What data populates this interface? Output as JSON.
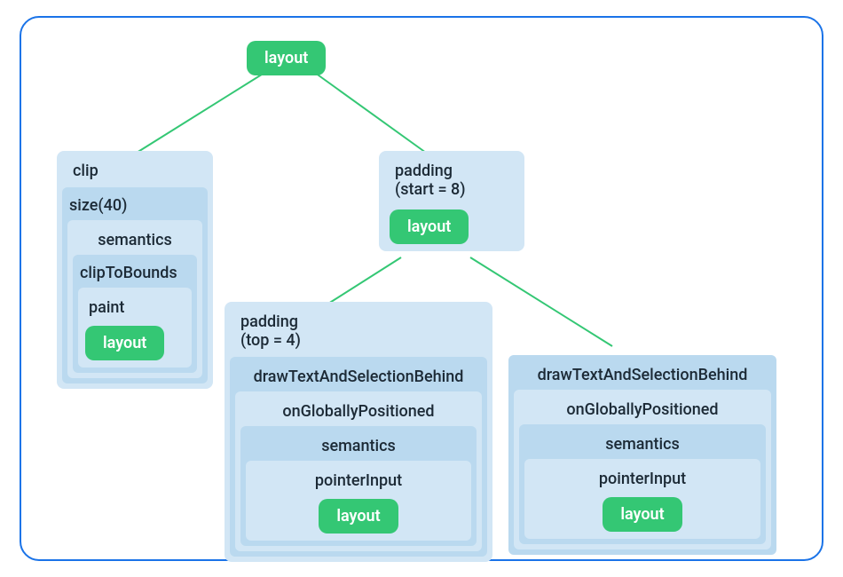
{
  "diagram": {
    "root_label": "layout",
    "left": {
      "title": "clip",
      "l1": "size(40)",
      "l2": "semantics",
      "l3": "clipToBounds",
      "l4": "paint",
      "leaf": "layout"
    },
    "right": {
      "title_line1": "padding",
      "title_line2": "(start = 8)",
      "leaf": "layout",
      "child_left": {
        "title_line1": "padding",
        "title_line2": "(top = 4)",
        "l1": "drawTextAndSelectionBehind",
        "l2": "onGloballyPositioned",
        "l3": "semantics",
        "l4": "pointerInput",
        "leaf": "layout"
      },
      "child_right": {
        "l1": "drawTextAndSelectionBehind",
        "l2": "onGloballyPositioned",
        "l3": "semantics",
        "l4": "pointerInput",
        "leaf": "layout"
      }
    }
  }
}
